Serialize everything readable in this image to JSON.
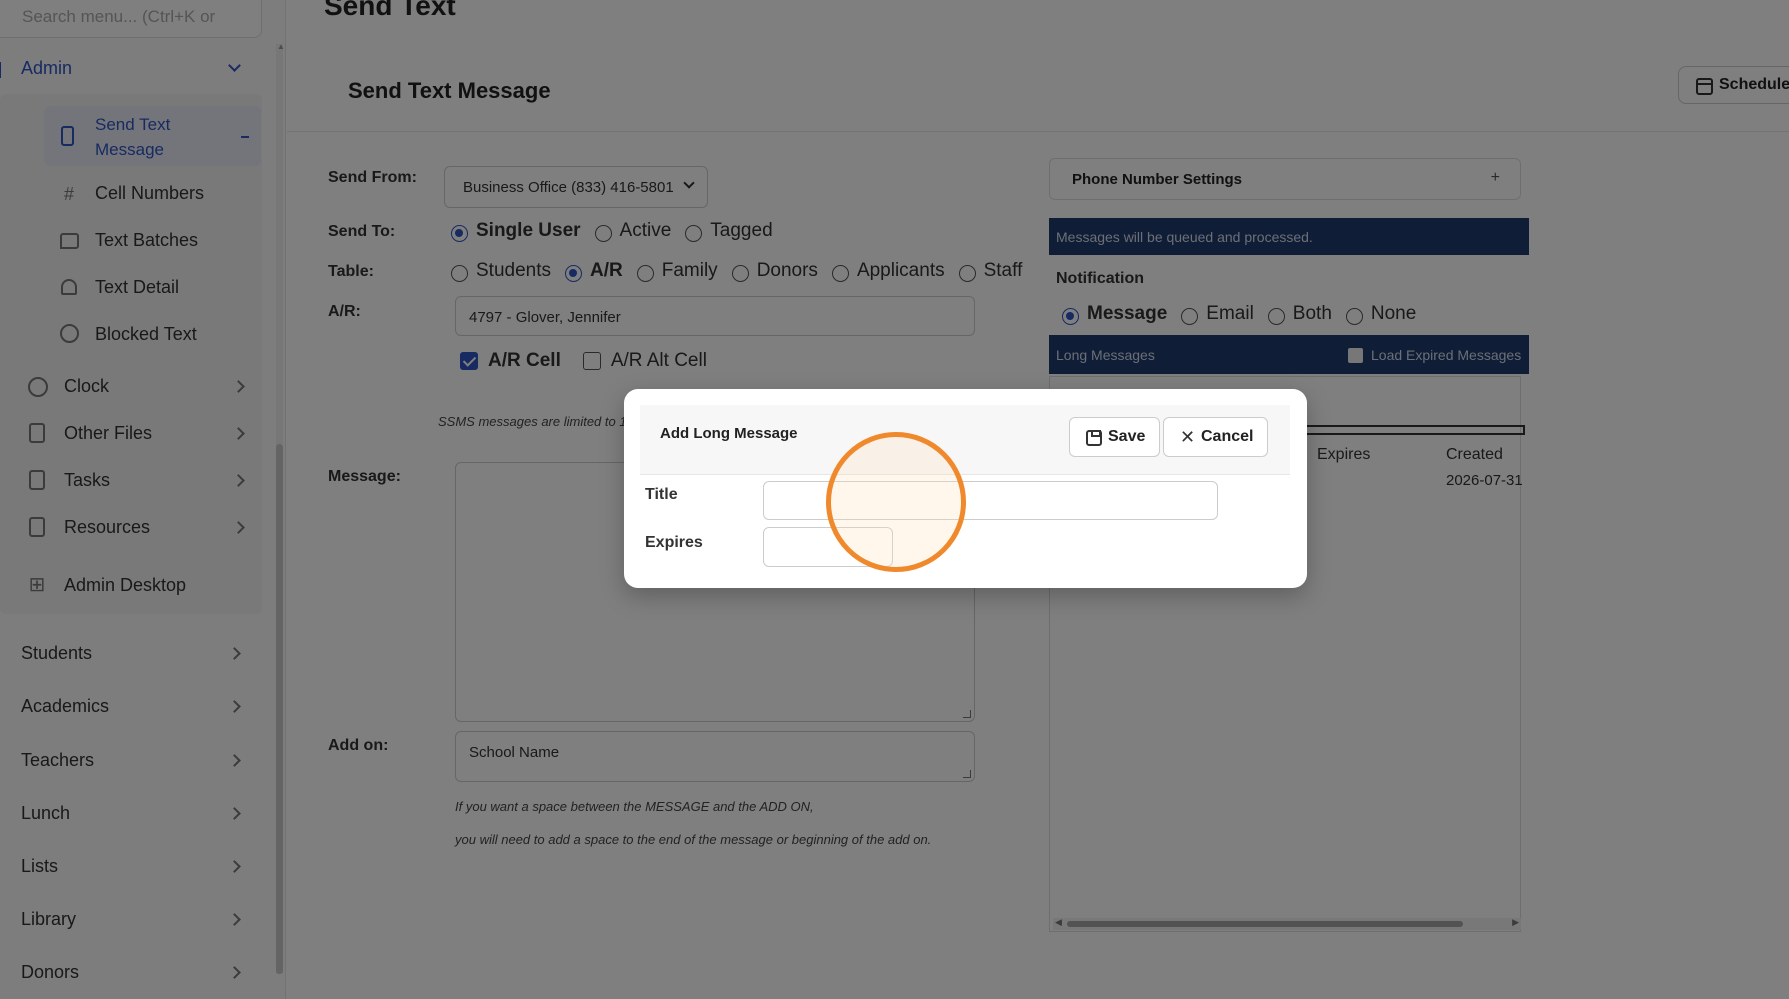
{
  "sidebar": {
    "search_placeholder": "Search menu... (Ctrl+K or",
    "admin_label": "Admin",
    "admin_items": [
      {
        "label": "Send Text Message",
        "icon": "phone-icon",
        "active": true
      },
      {
        "label": "Cell Numbers",
        "icon": "hash-icon"
      },
      {
        "label": "Text Batches",
        "icon": "message-icon"
      },
      {
        "label": "Text Detail",
        "icon": "bell-icon"
      },
      {
        "label": "Blocked Text",
        "icon": "blocked-icon"
      }
    ],
    "admin_sub_groups": [
      {
        "label": "Clock",
        "icon": "clock-icon"
      },
      {
        "label": "Other Files",
        "icon": "file-icon"
      },
      {
        "label": "Tasks",
        "icon": "clipboard-icon"
      },
      {
        "label": "Resources",
        "icon": "document-icon"
      }
    ],
    "admin_desktop": "Admin Desktop",
    "sections": [
      "Students",
      "Academics",
      "Teachers",
      "Lunch",
      "Lists",
      "Library",
      "Donors"
    ]
  },
  "page": {
    "heading": "Send Text",
    "card_title": "Send Text Message",
    "schedule_label": "Schedule"
  },
  "form": {
    "send_from_label": "Send From:",
    "send_from_value": "Business Office (833) 416-5801",
    "send_to_label": "Send To:",
    "send_to_options": [
      {
        "label": "Single User",
        "selected": true
      },
      {
        "label": "Active",
        "selected": false
      },
      {
        "label": "Tagged",
        "selected": false
      }
    ],
    "table_label": "Table:",
    "table_options": [
      {
        "label": "Students",
        "selected": false
      },
      {
        "label": "A/R",
        "selected": true
      },
      {
        "label": "Family",
        "selected": false
      },
      {
        "label": "Donors",
        "selected": false
      },
      {
        "label": "Applicants",
        "selected": false
      },
      {
        "label": "Staff",
        "selected": false
      }
    ],
    "ar_label": "A/R:",
    "ar_value": "4797 - Glover, Jennifer",
    "ar_cell_label": "A/R Cell",
    "ar_cell_checked": true,
    "ar_alt_cell_label": "A/R Alt Cell",
    "ar_alt_cell_checked": false,
    "sms_note": "SSMS messages are limited to 1",
    "message_label": "Message:",
    "add_on_label": "Add on:",
    "add_on_value": "School Name",
    "hint_line1": "If you want a space between the MESSAGE and the ADD ON,",
    "hint_line2": "you will need to add a space to the end of the message or beginning of the add on."
  },
  "right_panel": {
    "phone_settings_label": "Phone Number Settings",
    "phone_settings_plus": "+",
    "queued_info": "Messages will be queued and processed.",
    "notification_label": "Notification",
    "notification_options": [
      {
        "label": "Message",
        "selected": true
      },
      {
        "label": "Email",
        "selected": false
      },
      {
        "label": "Both",
        "selected": false
      },
      {
        "label": "None",
        "selected": false
      }
    ],
    "long_messages_label": "Long Messages",
    "load_expired_label": "Load Expired Messages",
    "columns": [
      "Expires",
      "Created"
    ],
    "rows": [
      {
        "created": "2026-07-31"
      }
    ]
  },
  "modal": {
    "title": "Add Long Message",
    "save_label": "Save",
    "cancel_label": "Cancel",
    "title_field_label": "Title",
    "title_value": "",
    "expires_field_label": "Expires",
    "expires_value": ""
  },
  "colors": {
    "accent": "#2f55c2",
    "banner": "#1f3a6e",
    "cursor_ring": "#f0892b"
  }
}
